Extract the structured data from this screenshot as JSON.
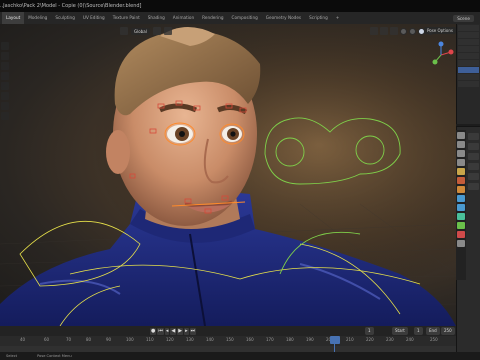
{
  "window": {
    "title": "..Jaschko\\Pack 2\\Model - Copie (0)\\Source\\Blender.blend]"
  },
  "workspaces": {
    "tabs": [
      "Layout",
      "Modeling",
      "Sculpting",
      "UV Editing",
      "Texture Paint",
      "Shading",
      "Animation",
      "Rendering",
      "Compositing",
      "Geometry Nodes",
      "Scripting",
      "+"
    ],
    "active_index": 0,
    "scene_label": "Scene"
  },
  "viewport_header": {
    "mode": "Global",
    "pose_options": "Pose Options"
  },
  "timeline": {
    "current_frame": "1",
    "start_label": "Start",
    "start_value": "1",
    "end_label": "End",
    "end_value": "250",
    "ruler_labels": [
      "40",
      "60",
      "70",
      "80",
      "90",
      "100",
      "110",
      "120",
      "130",
      "140",
      "150",
      "160",
      "170",
      "180",
      "190",
      "200",
      "210",
      "220",
      "230",
      "240",
      "250"
    ]
  },
  "status": {
    "item1": "Select",
    "item2": "Pose Context Menu"
  },
  "colors": {
    "accent_blue": "#4772b3",
    "bone_orange": "#ff8a2a",
    "bone_red": "#d64a3a",
    "ctrl_yellow": "#e7e14a",
    "ctrl_green": "#7fd04a"
  }
}
